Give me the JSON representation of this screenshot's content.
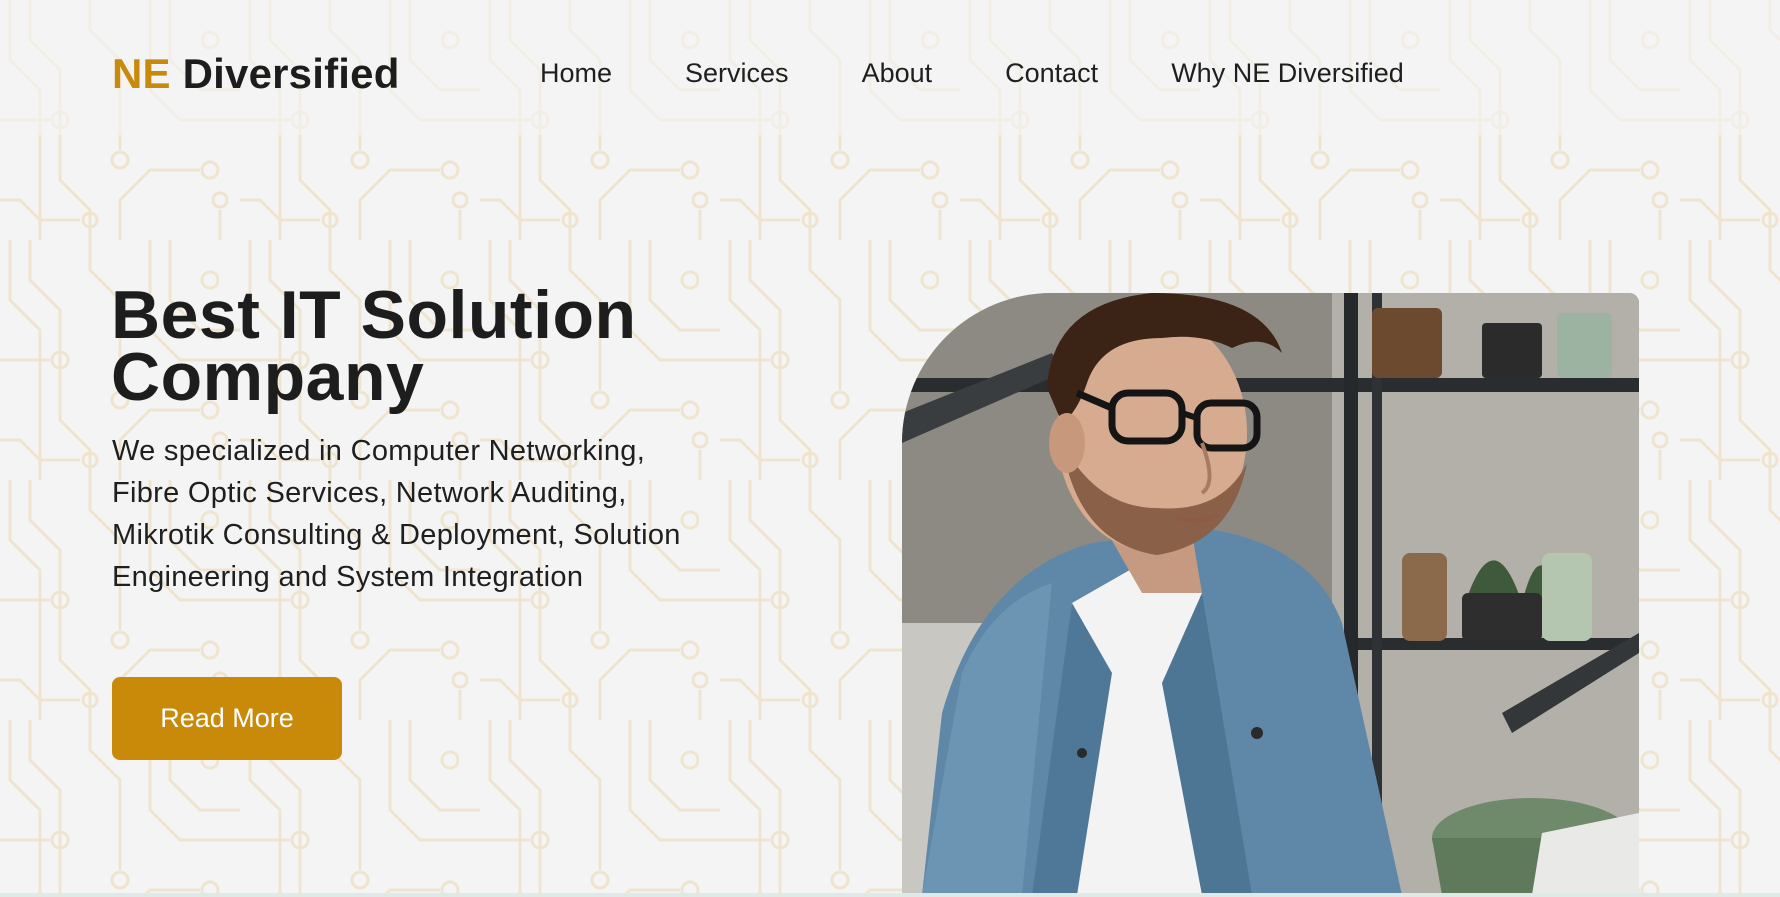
{
  "brand": {
    "accent_part": "NE",
    "main_part": "Diversified",
    "accent_color": "#c88a0c"
  },
  "nav": {
    "items": [
      {
        "label": "Home"
      },
      {
        "label": "Services"
      },
      {
        "label": "About"
      },
      {
        "label": "Contact"
      },
      {
        "label": "Why NE Diversified"
      }
    ]
  },
  "hero": {
    "title": "Best IT Solution Company",
    "description": "We specialized in Computer Networking, Fibre Optic Services, Network Auditing, Mikrotik Consulting & Deployment, Solution Engineering and System Integration",
    "button_label": "Read More",
    "button_color": "#c98a0a",
    "image_icon": "man-at-laptop-photo"
  },
  "background": {
    "pattern": "circuit-board-pattern",
    "pattern_color": "#efe6d3"
  }
}
